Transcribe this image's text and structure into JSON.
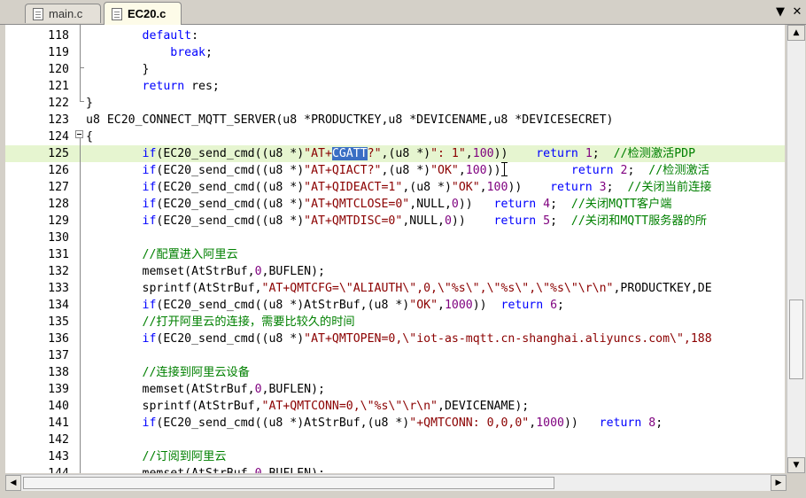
{
  "tabs": [
    {
      "label": "main.c",
      "active": false
    },
    {
      "label": "EC20.c",
      "active": true
    }
  ],
  "tab_controls": {
    "dropdown_icon": "chevron-down-icon",
    "close_icon": "close-icon",
    "dropdown_glyph": "▼",
    "close_glyph": "✕"
  },
  "editor": {
    "lines": [
      {
        "n": "118",
        "segs": [
          [
            "pln",
            "        "
          ],
          [
            "kw",
            "default"
          ],
          [
            "pln",
            ":"
          ]
        ]
      },
      {
        "n": "119",
        "segs": [
          [
            "pln",
            "            "
          ],
          [
            "kw",
            "break"
          ],
          [
            "pln",
            ";"
          ]
        ]
      },
      {
        "n": "120",
        "segs": [
          [
            "pln",
            "        }"
          ]
        ]
      },
      {
        "n": "121",
        "segs": [
          [
            "pln",
            "        "
          ],
          [
            "kw",
            "return"
          ],
          [
            "pln",
            " res;"
          ]
        ]
      },
      {
        "n": "122",
        "segs": [
          [
            "pln",
            "}"
          ]
        ]
      },
      {
        "n": "123",
        "segs": [
          [
            "pln",
            "u8 EC20_CONNECT_MQTT_SERVER(u8 *PRODUCTKEY,u8 *DEVICENAME,u8 *DEVICESECRET)"
          ]
        ]
      },
      {
        "n": "124",
        "segs": [
          [
            "pln",
            "{"
          ]
        ]
      },
      {
        "n": "125",
        "hl": true,
        "segs": [
          [
            "pln",
            "        "
          ],
          [
            "kw",
            "if"
          ],
          [
            "pln",
            "(EC20_send_cmd((u8 *)"
          ],
          [
            "str",
            "\"AT+"
          ],
          [
            "sel",
            "CGATT"
          ],
          [
            "str",
            "?\""
          ],
          [
            "pln",
            ",(u8 *)"
          ],
          [
            "str",
            "\": 1\""
          ],
          [
            "pln",
            ","
          ],
          [
            "num",
            "100"
          ],
          [
            "pln",
            "))    "
          ],
          [
            "kw",
            "return"
          ],
          [
            "pln",
            " "
          ],
          [
            "num",
            "1"
          ],
          [
            "pln",
            ";  "
          ],
          [
            "cmt",
            "//检测激活PDP"
          ]
        ]
      },
      {
        "n": "126",
        "segs": [
          [
            "pln",
            "        "
          ],
          [
            "kw",
            "if"
          ],
          [
            "pln",
            "(EC20_send_cmd((u8 *)"
          ],
          [
            "str",
            "\"AT+QIACT?\""
          ],
          [
            "pln",
            ",(u8 *)"
          ],
          [
            "str",
            "\"OK\""
          ],
          [
            "pln",
            ","
          ],
          [
            "num",
            "100"
          ],
          [
            "pln",
            "))          "
          ],
          [
            "kw",
            "return"
          ],
          [
            "pln",
            " "
          ],
          [
            "num",
            "2"
          ],
          [
            "pln",
            ";  "
          ],
          [
            "cmt",
            "//检测激活"
          ]
        ]
      },
      {
        "n": "127",
        "segs": [
          [
            "pln",
            "        "
          ],
          [
            "kw",
            "if"
          ],
          [
            "pln",
            "(EC20_send_cmd((u8 *)"
          ],
          [
            "str",
            "\"AT+QIDEACT=1\""
          ],
          [
            "pln",
            ",(u8 *)"
          ],
          [
            "str",
            "\"OK\""
          ],
          [
            "pln",
            ","
          ],
          [
            "num",
            "100"
          ],
          [
            "pln",
            "))    "
          ],
          [
            "kw",
            "return"
          ],
          [
            "pln",
            " "
          ],
          [
            "num",
            "3"
          ],
          [
            "pln",
            ";  "
          ],
          [
            "cmt",
            "//关闭当前连接"
          ]
        ]
      },
      {
        "n": "128",
        "segs": [
          [
            "pln",
            "        "
          ],
          [
            "kw",
            "if"
          ],
          [
            "pln",
            "(EC20_send_cmd((u8 *)"
          ],
          [
            "str",
            "\"AT+QMTCLOSE=0\""
          ],
          [
            "pln",
            ",NULL,"
          ],
          [
            "num",
            "0"
          ],
          [
            "pln",
            "))   "
          ],
          [
            "kw",
            "return"
          ],
          [
            "pln",
            " "
          ],
          [
            "num",
            "4"
          ],
          [
            "pln",
            ";  "
          ],
          [
            "cmt",
            "//关闭MQTT客户端"
          ]
        ]
      },
      {
        "n": "129",
        "segs": [
          [
            "pln",
            "        "
          ],
          [
            "kw",
            "if"
          ],
          [
            "pln",
            "(EC20_send_cmd((u8 *)"
          ],
          [
            "str",
            "\"AT+QMTDISC=0\""
          ],
          [
            "pln",
            ",NULL,"
          ],
          [
            "num",
            "0"
          ],
          [
            "pln",
            "))    "
          ],
          [
            "kw",
            "return"
          ],
          [
            "pln",
            " "
          ],
          [
            "num",
            "5"
          ],
          [
            "pln",
            ";  "
          ],
          [
            "cmt",
            "//关闭和MQTT服务器的所"
          ]
        ]
      },
      {
        "n": "130",
        "segs": [
          [
            "pln",
            ""
          ]
        ]
      },
      {
        "n": "131",
        "segs": [
          [
            "pln",
            "        "
          ],
          [
            "cmt",
            "//配置进入阿里云"
          ]
        ]
      },
      {
        "n": "132",
        "segs": [
          [
            "pln",
            "        memset(AtStrBuf,"
          ],
          [
            "num",
            "0"
          ],
          [
            "pln",
            ",BUFLEN);"
          ]
        ]
      },
      {
        "n": "133",
        "segs": [
          [
            "pln",
            "        sprintf(AtStrBuf,"
          ],
          [
            "str",
            "\"AT+QMTCFG=\\\"ALIAUTH\\\",0,\\\"%s\\\",\\\"%s\\\",\\\"%s\\\"\\r\\n\""
          ],
          [
            "pln",
            ",PRODUCTKEY,DE"
          ]
        ]
      },
      {
        "n": "134",
        "segs": [
          [
            "pln",
            "        "
          ],
          [
            "kw",
            "if"
          ],
          [
            "pln",
            "(EC20_send_cmd((u8 *)AtStrBuf,(u8 *)"
          ],
          [
            "str",
            "\"OK\""
          ],
          [
            "pln",
            ","
          ],
          [
            "num",
            "1000"
          ],
          [
            "pln",
            "))  "
          ],
          [
            "kw",
            "return"
          ],
          [
            "pln",
            " "
          ],
          [
            "num",
            "6"
          ],
          [
            "pln",
            ";"
          ]
        ]
      },
      {
        "n": "135",
        "segs": [
          [
            "pln",
            "        "
          ],
          [
            "cmt",
            "//打开阿里云的连接，需要比较久的时间"
          ]
        ]
      },
      {
        "n": "136",
        "segs": [
          [
            "pln",
            "        "
          ],
          [
            "kw",
            "if"
          ],
          [
            "pln",
            "(EC20_send_cmd((u8 *)"
          ],
          [
            "str",
            "\"AT+QMTOPEN=0,\\\"iot-as-mqtt.cn-shanghai.aliyuncs.com\\\",188"
          ]
        ]
      },
      {
        "n": "137",
        "segs": [
          [
            "pln",
            ""
          ]
        ]
      },
      {
        "n": "138",
        "segs": [
          [
            "pln",
            "        "
          ],
          [
            "cmt",
            "//连接到阿里云设备"
          ]
        ]
      },
      {
        "n": "139",
        "segs": [
          [
            "pln",
            "        memset(AtStrBuf,"
          ],
          [
            "num",
            "0"
          ],
          [
            "pln",
            ",BUFLEN);"
          ]
        ]
      },
      {
        "n": "140",
        "segs": [
          [
            "pln",
            "        sprintf(AtStrBuf,"
          ],
          [
            "str",
            "\"AT+QMTCONN=0,\\\"%s\\\"\\r\\n\""
          ],
          [
            "pln",
            ",DEVICENAME);"
          ]
        ]
      },
      {
        "n": "141",
        "segs": [
          [
            "pln",
            "        "
          ],
          [
            "kw",
            "if"
          ],
          [
            "pln",
            "(EC20_send_cmd((u8 *)AtStrBuf,(u8 *)"
          ],
          [
            "str",
            "\"+QMTCONN: 0,0,0\""
          ],
          [
            "pln",
            ","
          ],
          [
            "num",
            "1000"
          ],
          [
            "pln",
            "))   "
          ],
          [
            "kw",
            "return"
          ],
          [
            "pln",
            " "
          ],
          [
            "num",
            "8"
          ],
          [
            "pln",
            ";"
          ]
        ]
      },
      {
        "n": "142",
        "segs": [
          [
            "pln",
            ""
          ]
        ]
      },
      {
        "n": "143",
        "segs": [
          [
            "pln",
            "        "
          ],
          [
            "cmt",
            "//订阅到阿里云"
          ]
        ]
      },
      {
        "n": "144",
        "segs": [
          [
            "pln",
            "        memset(AtStrBuf,"
          ],
          [
            "num",
            "0"
          ],
          [
            "pln",
            ",BUFLEN);"
          ]
        ]
      }
    ]
  },
  "scrollbars": {
    "up_glyph": "▲",
    "down_glyph": "▼",
    "left_glyph": "◀",
    "right_glyph": "▶"
  }
}
